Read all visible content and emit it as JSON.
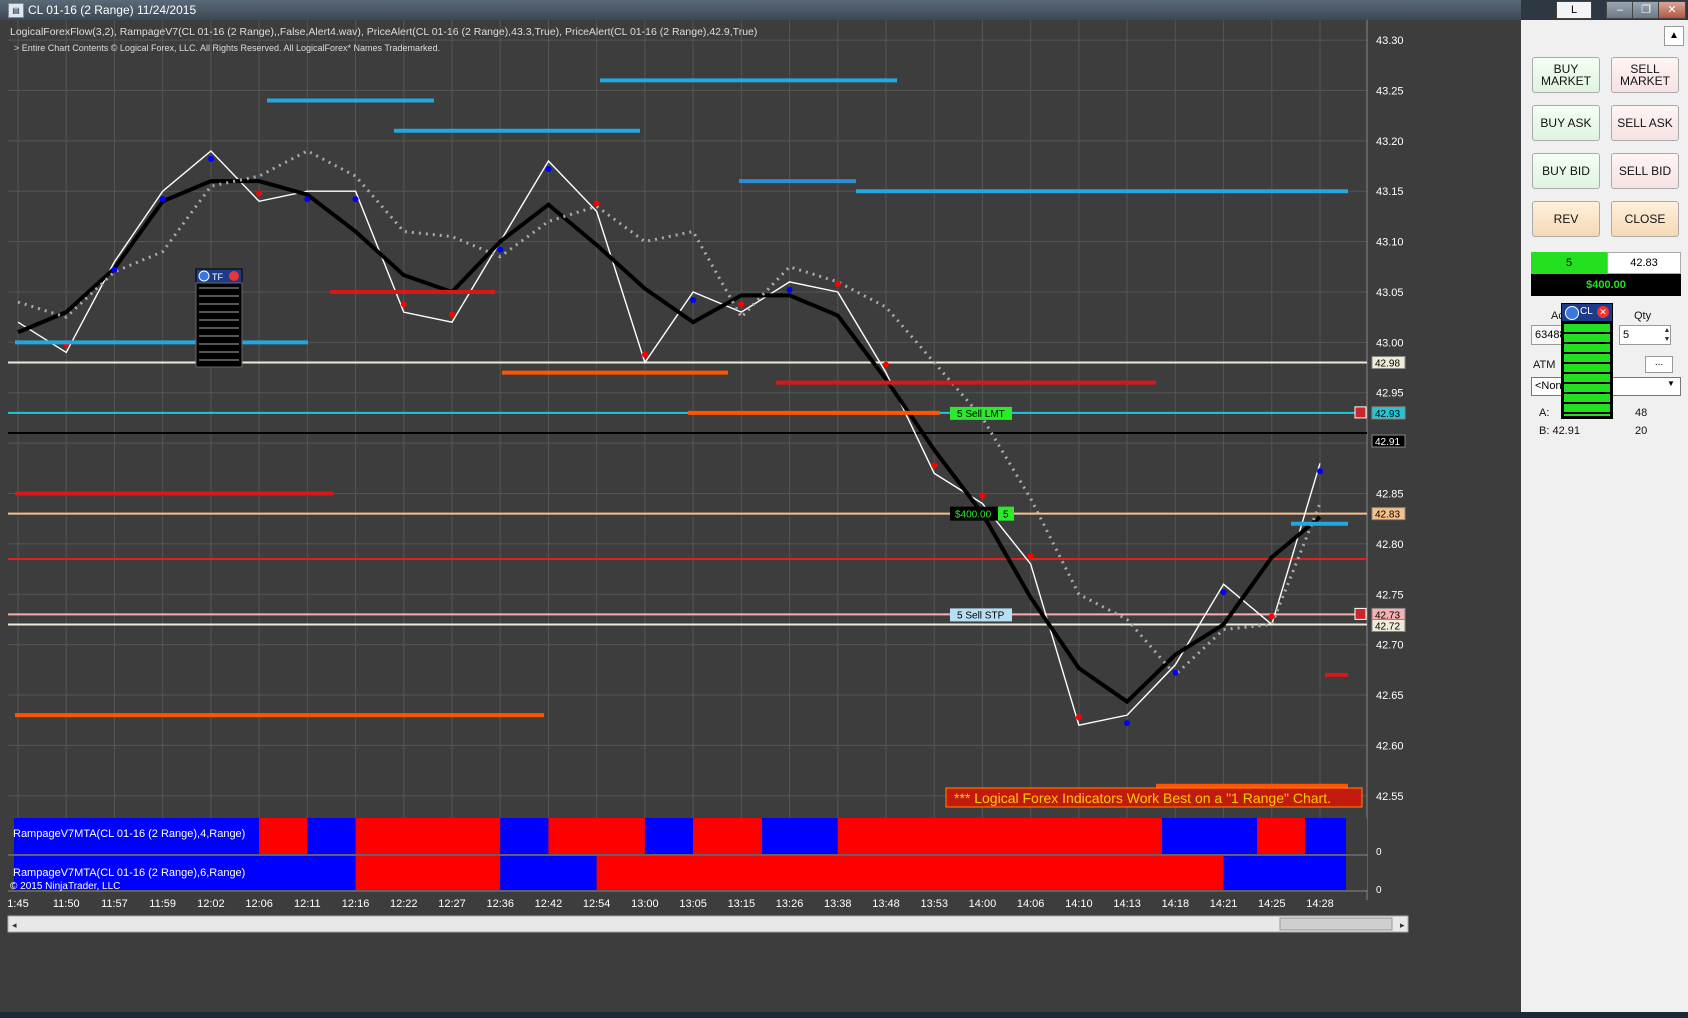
{
  "window": {
    "title": "CL 01-16 (2 Range)  11/24/2015",
    "controls": [
      "L",
      "–",
      "❐",
      "✕"
    ]
  },
  "chart": {
    "indicator_line": "LogicalForexFlow(3,2), RampageV7(CL 01-16 (2 Range),,False,Alert4.wav), PriceAlert(CL 01-16 (2 Range),43.3,True), PriceAlert(CL 01-16 (2 Range),42.9,True)",
    "copyright_line": "> Entire Chart Contents © Logical Forex, LLC. All Rights Reserved. All LogicalForex* Names Trademarked.",
    "banner": "*** Logical Forex Indicators Work Best on a \"1 Range\" Chart.",
    "y_ticks": [
      "43.30",
      "43.25",
      "43.20",
      "43.15",
      "43.10",
      "43.05",
      "43.00",
      "42.95",
      "42.90",
      "42.85",
      "42.80",
      "42.75",
      "42.70",
      "42.65",
      "42.60",
      "42.55"
    ],
    "x_ticks": [
      "1:45",
      "11:50",
      "11:57",
      "11:59",
      "12:02",
      "12:06",
      "12:11",
      "12:16",
      "12:22",
      "12:27",
      "12:36",
      "12:42",
      "12:54",
      "13:00",
      "13:05",
      "13:15",
      "13:26",
      "13:38",
      "13:48",
      "13:53",
      "14:00",
      "14:06",
      "14:10",
      "14:13",
      "14:18",
      "14:21",
      "14:25",
      "14:28"
    ],
    "price_markers": [
      {
        "label": "42.98",
        "color": "#f0ead8",
        "text_color": "#000"
      },
      {
        "label": "42.93",
        "color": "#22c6d6",
        "text_color": "#000"
      },
      {
        "label": "42.91",
        "color": "#000000",
        "text_color": "#fff"
      },
      {
        "label": "42.83",
        "color": "#f5c18a",
        "text_color": "#000"
      },
      {
        "label": "42.73",
        "color": "#f7b0b0",
        "text_color": "#000"
      },
      {
        "label": "42.72",
        "color": "#f0ead8",
        "text_color": "#000"
      }
    ],
    "orders": {
      "sell_lmt": {
        "qty": "5",
        "label": "Sell LMT"
      },
      "position": {
        "pnl": "$400.00",
        "qty": "5"
      },
      "sell_stp": {
        "qty": "5",
        "label": "Sell STP"
      }
    },
    "tf_widget_label": "TF",
    "panel1_label": "RampageV7MTA(CL 01-16 (2 Range),4,Range)",
    "panel2_label": "RampageV7MTA(CL 01-16 (2 Range),6,Range)",
    "panel_zero": "0",
    "ninja_copyright": "© 2015 NinjaTrader, LLC",
    "colors": {
      "bg": "#3d3d3d",
      "red": "#ff0000",
      "blue": "#0000ff",
      "price": "#ffffff",
      "ma": "#000000"
    }
  },
  "chart_data": {
    "type": "line",
    "title": "CL 01-16 (2 Range)  11/24/2015",
    "xlabel": "",
    "ylabel": "",
    "ylim": [
      42.52,
      43.31
    ],
    "grid": true,
    "series": [
      {
        "x": [
          "1:45",
          "11:50",
          "11:57",
          "11:59",
          "12:02",
          "12:06",
          "12:11",
          "12:16",
          "12:22",
          "12:27",
          "12:36",
          "12:42",
          "12:54",
          "13:00",
          "13:05",
          "13:15",
          "13:26",
          "13:38",
          "13:48",
          "13:53",
          "14:00",
          "14:06",
          "14:10",
          "14:13",
          "14:18",
          "14:21",
          "14:25",
          "14:28"
        ],
        "values": [
          43.02,
          42.99,
          43.08,
          43.15,
          43.19,
          43.14,
          43.15,
          43.15,
          43.03,
          43.02,
          43.1,
          43.18,
          43.13,
          42.98,
          43.05,
          43.03,
          43.06,
          43.05,
          42.97,
          42.87,
          42.84,
          42.78,
          42.62,
          42.63,
          42.68,
          42.76,
          42.72,
          42.88
        ]
      }
    ],
    "price_levels": [
      42.98,
      42.93,
      42.91,
      42.83,
      42.73,
      42.72
    ],
    "mta_panel_4": [
      {
        "from": "1:45",
        "to": "12:06",
        "color": "blue"
      },
      {
        "from": "12:06",
        "to": "12:11",
        "color": "red"
      },
      {
        "from": "12:11",
        "to": "12:16",
        "color": "blue"
      },
      {
        "from": "12:16",
        "to": "12:36",
        "color": "red"
      },
      {
        "from": "12:36",
        "to": "12:42",
        "color": "blue"
      },
      {
        "from": "12:42",
        "to": "13:00",
        "color": "red"
      },
      {
        "from": "13:00",
        "to": "13:05",
        "color": "blue"
      },
      {
        "from": "13:05",
        "to": "13:10",
        "color": "red"
      },
      {
        "from": "13:10",
        "to": "13:38",
        "color": "blue"
      },
      {
        "from": "13:38",
        "to": "14:16",
        "color": "red"
      },
      {
        "from": "14:16",
        "to": "14:22",
        "color": "blue"
      },
      {
        "from": "14:22",
        "to": "14:26",
        "color": "red"
      },
      {
        "from": "14:26",
        "to": "14:28",
        "color": "blue"
      }
    ],
    "mta_panel_6": [
      {
        "from": "1:45",
        "to": "12:16",
        "color": "blue"
      },
      {
        "from": "12:16",
        "to": "12:36",
        "color": "red"
      },
      {
        "from": "12:36",
        "to": "12:54",
        "color": "blue"
      },
      {
        "from": "12:54",
        "to": "14:21",
        "color": "red"
      },
      {
        "from": "14:21",
        "to": "14:28",
        "color": "blue"
      }
    ]
  },
  "order_panel": {
    "buy_market": "BUY MARKET",
    "sell_market": "SELL MARKET",
    "buy_ask": "BUY ASK",
    "sell_ask": "SELL ASK",
    "buy_bid": "BUY BID",
    "sell_bid": "SELL BID",
    "rev": "REV",
    "close": "CLOSE",
    "position_qty": "5",
    "position_price": "42.83",
    "pnl": "$400.00",
    "account_label": "Account",
    "qty_label": "Qty",
    "account_value": "63488",
    "qty_value": "5",
    "atm_label": "ATM",
    "atm_value": "<None",
    "atm_more": "...",
    "ask_label": "A:",
    "ask_value": "48",
    "bid_label": "B: 42.91",
    "bid_value": "20",
    "cl_widget_label": "CL"
  }
}
